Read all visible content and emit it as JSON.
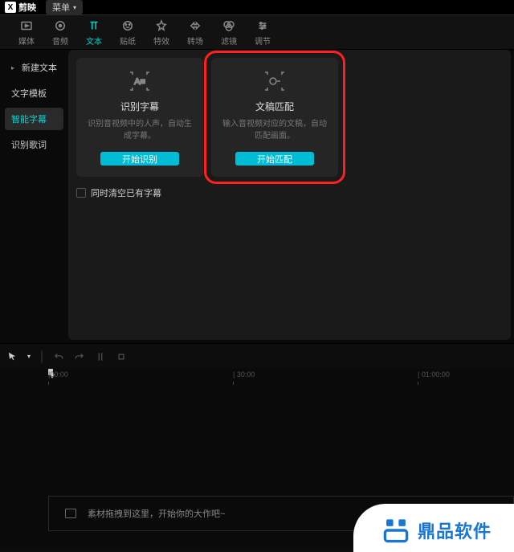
{
  "topbar": {
    "logo_text": "剪映",
    "menu_label": "菜单"
  },
  "tabs": [
    {
      "label": "媒体"
    },
    {
      "label": "音频"
    },
    {
      "label": "文本"
    },
    {
      "label": "贴纸"
    },
    {
      "label": "特效"
    },
    {
      "label": "转场"
    },
    {
      "label": "滤镜"
    },
    {
      "label": "调节"
    }
  ],
  "sidebar": {
    "items": [
      {
        "label": "新建文本",
        "expandable": true
      },
      {
        "label": "文字模板"
      },
      {
        "label": "智能字幕",
        "active": true
      },
      {
        "label": "识别歌词"
      }
    ]
  },
  "cards": [
    {
      "title": "识别字幕",
      "desc": "识别音视频中的人声，自动生成字幕。",
      "btn": "开始识别"
    },
    {
      "title": "文稿匹配",
      "desc": "输入音视频对应的文稿，自动匹配画面。",
      "btn": "开始匹配"
    }
  ],
  "checkbox_label": "同时清空已有字幕",
  "ruler": {
    "t0": "|00:00",
    "t1": "| 30:00",
    "t2": "| 01:00:00"
  },
  "track_placeholder": "素材拖拽到这里，开始你的大作吧~",
  "watermark": "鼎品软件"
}
